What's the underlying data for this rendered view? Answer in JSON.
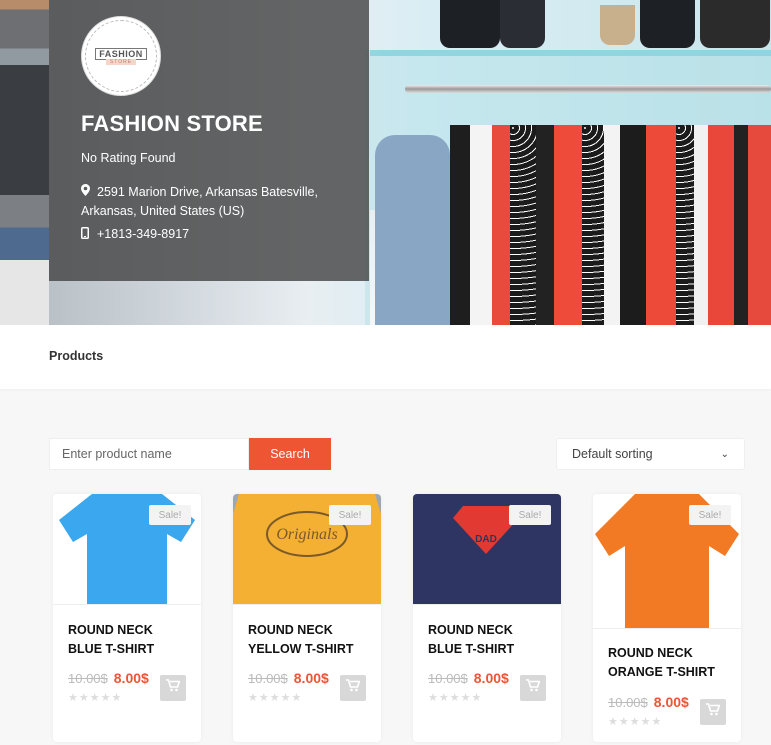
{
  "store": {
    "logo_text": "FASHION",
    "logo_sub": "STORE",
    "name": "FASHION STORE",
    "rating": "No Rating Found",
    "address": "2591 Marion Drive, Arkansas Batesville, Arkansas, United States (US)",
    "phone": "+1813-349-8917",
    "icons": {
      "address": "map-marker-icon",
      "phone": "mobile-phone-icon"
    }
  },
  "tabs": {
    "products": "Products"
  },
  "search": {
    "placeholder": "Enter product name",
    "value": "",
    "button": "Search"
  },
  "sort": {
    "selected": "Default sorting"
  },
  "colors": {
    "accent": "#ee5533",
    "sale_badge_bg": "#f3f3f3",
    "cart_button": "#d8d8d8"
  },
  "products": [
    {
      "title": "ROUND NECK BLUE T-SHIRT",
      "badge": "Sale!",
      "old_price": "10.00$",
      "new_price": "8.00$",
      "rating": 0,
      "stars": "★★★★★",
      "shirt_color": "#3aa7ee",
      "bg": "#ffffff"
    },
    {
      "title": "ROUND NECK YELLOW T-SHIRT",
      "badge": "Sale!",
      "old_price": "10.00$",
      "new_price": "8.00$",
      "rating": 0,
      "stars": "★★★★★",
      "shirt_color": "#f4b032",
      "bg": "#9da7b3",
      "print": "Originals"
    },
    {
      "title": "ROUND NECK BLUE T-SHIRT",
      "badge": "Sale!",
      "old_price": "10.00$",
      "new_price": "8.00$",
      "rating": 0,
      "stars": "★★★★★",
      "shirt_color": "#2f3563",
      "bg": "#a6adb8",
      "print": "DAD"
    },
    {
      "title": "ROUND NECK ORANGE T-SHIRT",
      "badge": "Sale!",
      "old_price": "10.00$",
      "new_price": "8.00$",
      "rating": 0,
      "stars": "★★★★★",
      "shirt_color": "#f27a25",
      "bg": "#ffffff"
    }
  ]
}
